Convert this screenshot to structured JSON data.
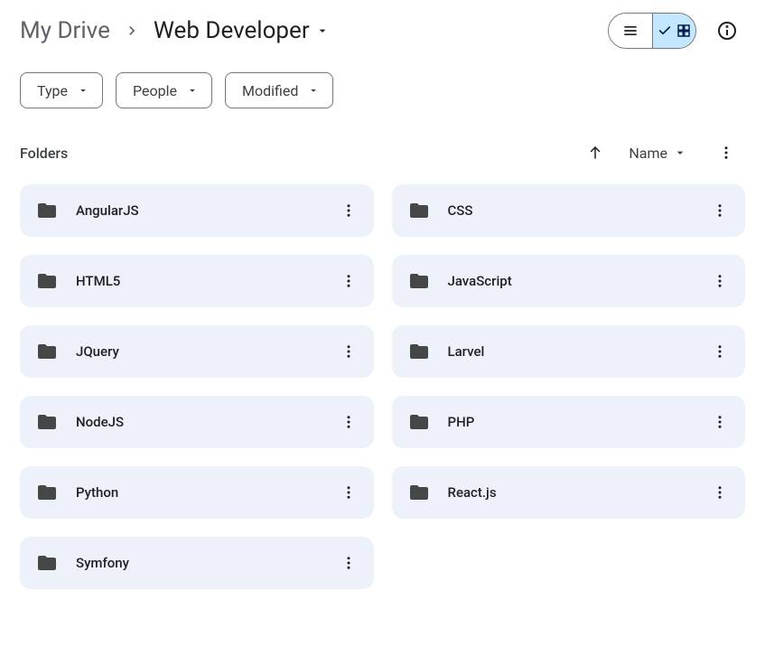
{
  "breadcrumb": {
    "root": "My Drive",
    "current": "Web Developer"
  },
  "filters": {
    "type": "Type",
    "people": "People",
    "modified": "Modified"
  },
  "section": {
    "title": "Folders",
    "sort_label": "Name"
  },
  "folders": [
    {
      "name": "AngularJS"
    },
    {
      "name": "CSS"
    },
    {
      "name": "HTML5"
    },
    {
      "name": "JavaScript"
    },
    {
      "name": "JQuery"
    },
    {
      "name": "Larvel"
    },
    {
      "name": "NodeJS"
    },
    {
      "name": "PHP"
    },
    {
      "name": "Python"
    },
    {
      "name": "React.js"
    },
    {
      "name": "Symfony"
    }
  ]
}
